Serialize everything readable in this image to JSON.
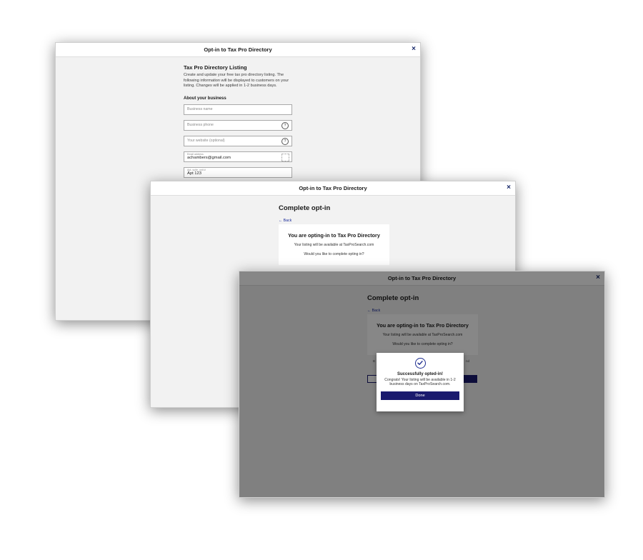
{
  "window1": {
    "title": "Opt-in to Tax Pro Directory",
    "close_glyph": "×",
    "heading": "Tax Pro Directory Listing",
    "description": "Create and update your free tax pro directory listing. The following information will be displayed to customers on your listing. Changes will be applied in 1-2 business days.",
    "section_title": "About your business",
    "fields": {
      "business_name": {
        "placeholder": "Business name"
      },
      "business_phone": {
        "placeholder": "Business phone"
      },
      "website": {
        "placeholder": "Your website (optional)"
      },
      "email": {
        "label": "Email address",
        "value": "achambers@gmail.com"
      },
      "apt": {
        "label": "Apt, suite, unit #",
        "value": "Apt 123"
      }
    }
  },
  "window2": {
    "title": "Opt-in to Tax Pro Directory",
    "close_glyph": "×",
    "heading": "Complete opt-in",
    "back_label": "← Back",
    "card": {
      "title": "You are opting-in to Tax Pro Directory",
      "line1": "Your listing will be available at TaxProSearch.com",
      "line2": "Would you like to complete opting in?"
    }
  },
  "window3": {
    "title": "Opt-in to Tax Pro Directory",
    "close_glyph": "×",
    "heading": "Complete opt-in",
    "back_label": "← Back",
    "card": {
      "title": "You are opting-in to Tax Pro Directory",
      "line1": "Your listing will be available at TaxProSearch.com",
      "line2": "Would you like to complete opting in?"
    },
    "hint_left": "B",
    "hint_right": "nd",
    "modal": {
      "title": "Successfully opted-in!",
      "text": "Congrats! Your listing will be available in 1-2 business days on TaxProSearch.com.",
      "done_label": "Done"
    }
  },
  "colors": {
    "primary": "#1a1a6e",
    "link": "#1a2b9b",
    "overlay": "rgba(0,0,0,0.47)"
  },
  "icons": {
    "help": "?",
    "success": "check-circle-icon"
  }
}
